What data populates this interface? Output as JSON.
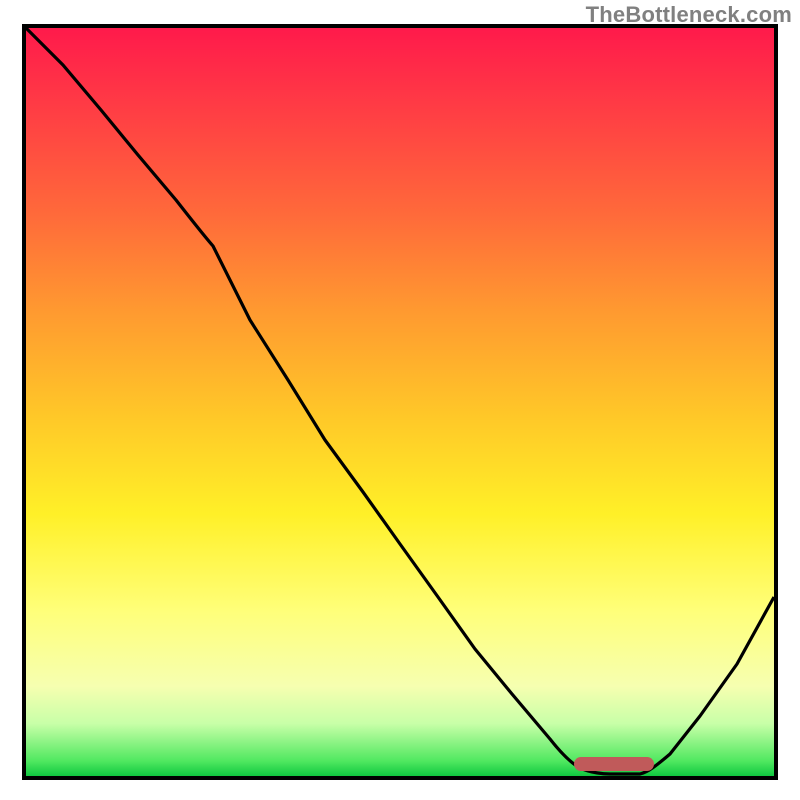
{
  "watermark": "TheBottleneck.com",
  "chart_data": {
    "type": "line",
    "title": "",
    "xlabel": "",
    "ylabel": "",
    "xlim": [
      0,
      1
    ],
    "ylim": [
      0,
      1
    ],
    "grid": false,
    "legend": false,
    "background": {
      "kind": "vertical-gradient",
      "stops": [
        {
          "pos": 0.0,
          "color": "#ff1a4b"
        },
        {
          "pos": 0.25,
          "color": "#ff6a3a"
        },
        {
          "pos": 0.52,
          "color": "#ffc828"
        },
        {
          "pos": 0.78,
          "color": "#ffff7a"
        },
        {
          "pos": 0.93,
          "color": "#c8ffa8"
        },
        {
          "pos": 1.0,
          "color": "#10c840"
        }
      ]
    },
    "series": [
      {
        "name": "bottleneck-curve",
        "color": "#000000",
        "x": [
          0.0,
          0.05,
          0.1,
          0.15,
          0.2,
          0.25,
          0.3,
          0.35,
          0.4,
          0.45,
          0.5,
          0.55,
          0.6,
          0.65,
          0.7,
          0.74,
          0.78,
          0.82,
          0.86,
          0.9,
          0.95,
          1.0
        ],
        "y": [
          1.0,
          0.95,
          0.89,
          0.83,
          0.77,
          0.7,
          0.61,
          0.53,
          0.45,
          0.38,
          0.31,
          0.24,
          0.17,
          0.11,
          0.05,
          0.01,
          0.0,
          0.0,
          0.03,
          0.08,
          0.15,
          0.24
        ]
      }
    ],
    "annotations": [
      {
        "name": "valley-marker",
        "shape": "rounded-rect",
        "color": "#c05a5a",
        "x_center": 0.79,
        "y_center": 0.005,
        "width_frac": 0.11,
        "height_frac": 0.018
      }
    ]
  }
}
